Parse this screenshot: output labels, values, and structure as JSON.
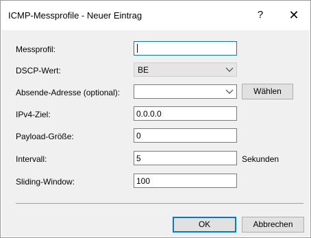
{
  "window": {
    "title": "ICMP-Messprofile - Neuer Eintrag",
    "help_glyph": "?",
    "close_glyph": "✕"
  },
  "form": {
    "messprofil": {
      "label": "Messprofil:",
      "value": ""
    },
    "dscp": {
      "label": "DSCP-Wert:",
      "value": "BE"
    },
    "absende": {
      "label": "Absende-Adresse (optional):",
      "value": "",
      "button_label": "Wählen"
    },
    "ipv4": {
      "label": "IPv4-Ziel:",
      "value": "0.0.0.0"
    },
    "payload": {
      "label": "Payload-Größe:",
      "value": "0"
    },
    "intervall": {
      "label": "Intervall:",
      "value": "5",
      "unit": "Sekunden"
    },
    "sliding": {
      "label": "Sliding-Window:",
      "value": "100"
    }
  },
  "buttons": {
    "ok": "OK",
    "cancel": "Abbrechen"
  },
  "icons": {
    "dropdown": "chevron-down-icon",
    "close": "close-icon",
    "help": "help-icon"
  },
  "colors": {
    "focus_border": "#0078d7",
    "dialog_bg": "#f0f0f0",
    "button_bg": "#e1e1e1"
  }
}
